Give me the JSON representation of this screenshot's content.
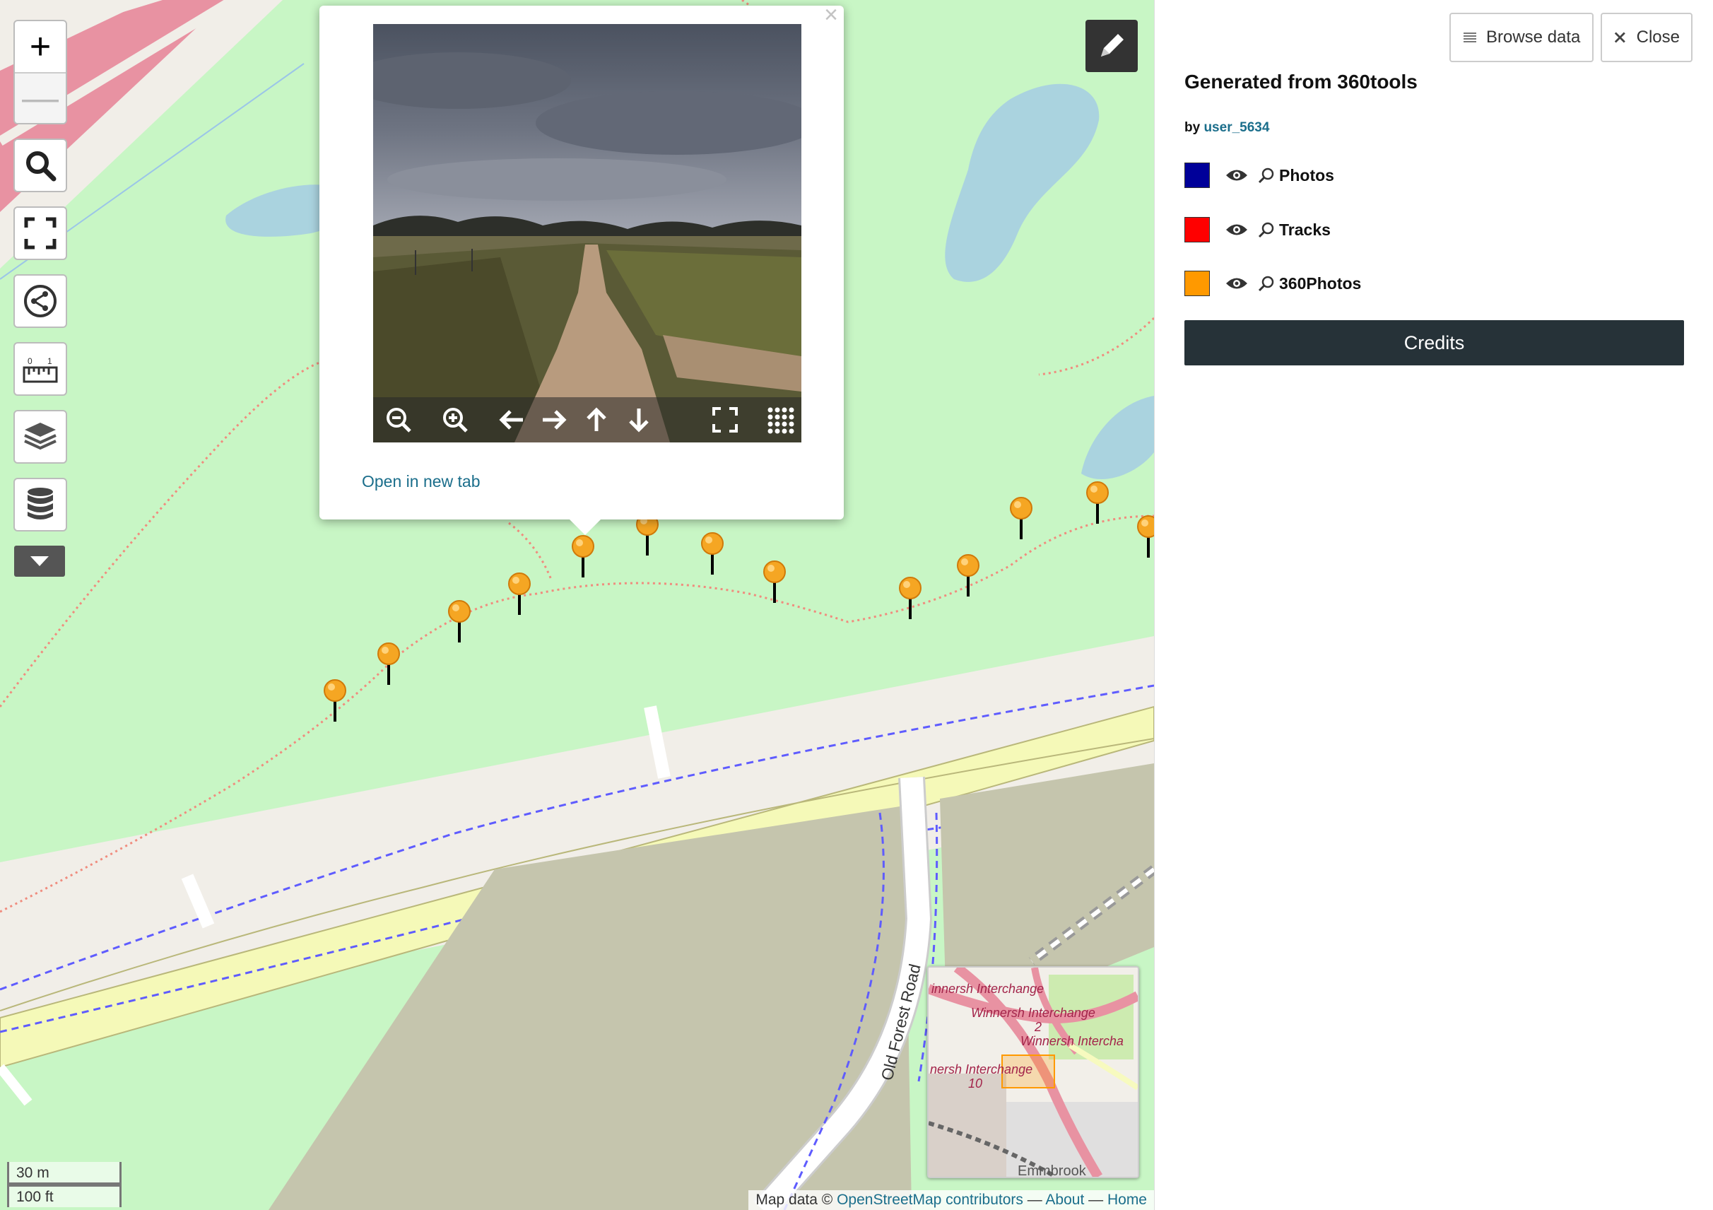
{
  "map": {
    "road_label": "Old Forest Road",
    "scale_metric": "30 m",
    "scale_imperial": "100 ft",
    "attribution_prefix": "Map data © ",
    "attribution_osm": "OpenStreetMap contributors",
    "attribution_about": "About",
    "attribution_home": "Home",
    "sep": " — "
  },
  "minimap": {
    "labels": [
      "innersh Interchange",
      "Winnersh Interchange",
      "2",
      "Winnersh Intercha",
      "nersh Interchange",
      "10",
      "Emmbrook"
    ]
  },
  "controls": {
    "zoom_in": "+",
    "zoom_out": "—"
  },
  "popup": {
    "close": "×",
    "open_link": "Open in new tab"
  },
  "panel": {
    "browse_label": "Browse data",
    "close_label": "Close",
    "title": "Generated from 360tools",
    "by_prefix": "by ",
    "author": "user_5634",
    "credits_label": "Credits",
    "layers": [
      {
        "name": "Photos",
        "color": "#000099"
      },
      {
        "name": "Tracks",
        "color": "#ff0000"
      },
      {
        "name": "360Photos",
        "color": "#ff9900"
      }
    ]
  },
  "colors": {
    "park": "#c8f6c5",
    "road_fill": "#f5f9b8",
    "pin": "#f5a623",
    "panel_button": "#263238",
    "link": "#1b6e8b"
  }
}
